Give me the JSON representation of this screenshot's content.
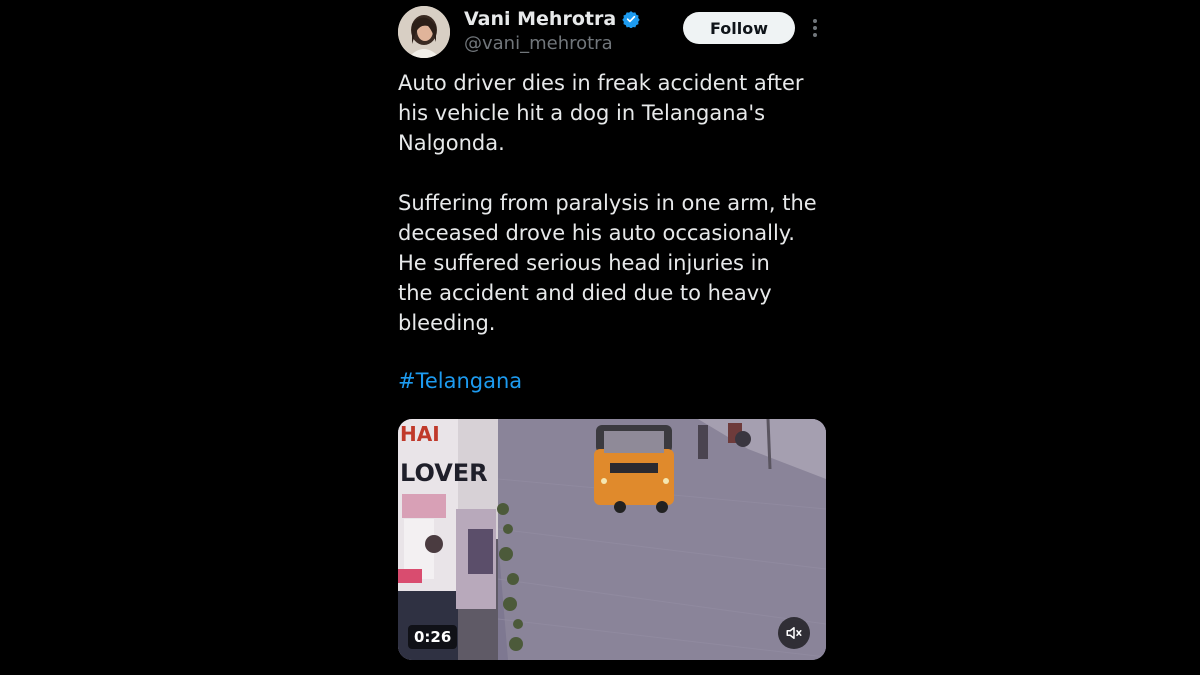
{
  "author": {
    "display_name": "Vani Mehrotra",
    "handle": "@vani_mehrotra",
    "verified_icon": "verified-badge-icon",
    "avatar_icon": "avatar"
  },
  "actions": {
    "follow_label": "Follow",
    "more_icon": "more-vertical-icon"
  },
  "tweet": {
    "text": "Auto driver dies in freak accident after\nhis vehicle hit a dog in Telangana's\nNalgonda.\n\nSuffering from paralysis in one arm, the\ndeceased drove his auto occasionally.\nHe suffered serious head injuries in\nthe accident and died due to heavy\nbleeding.",
    "hashtag": "#Telangana"
  },
  "video": {
    "duration": "0:26",
    "mute_icon": "volume-muted-icon",
    "poster_sign_text_1": "HAI",
    "poster_sign_text_2": "LOVER"
  },
  "colors": {
    "background": "#000000",
    "text": "#e7e9ea",
    "secondary_text": "#71767b",
    "link": "#1d9bf0",
    "verified": "#1d9bf0",
    "follow_bg": "#eff3f4"
  }
}
